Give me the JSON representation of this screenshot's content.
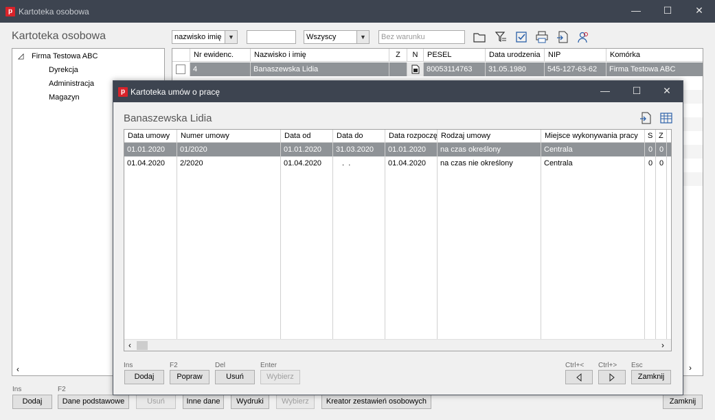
{
  "window": {
    "title": "Kartoteka osobowa"
  },
  "main": {
    "heading": "Kartoteka osobowa",
    "filter_field": "nazwisko imię",
    "search_value": "",
    "filter_scope": "Wszyscy",
    "condition_placeholder": "Bez warunku"
  },
  "tree": {
    "root": "Firma Testowa ABC",
    "children": [
      "Dyrekcja",
      "Administracja",
      "Magazyn"
    ]
  },
  "employees": {
    "columns": [
      "Nr ewidenc.",
      "Nazwisko i imię",
      "Z",
      "N",
      "PESEL",
      "Data urodzenia",
      "NIP",
      "Komórka"
    ],
    "rows": [
      {
        "nr": "4",
        "name": "Banaszewska Lidia",
        "z": "",
        "pesel": "80053114763",
        "birth": "31.05.1980",
        "nip": "545-127-63-62",
        "unit": "Firma Testowa ABC"
      }
    ]
  },
  "main_buttons": {
    "add_hotkey": "Ins",
    "add": "Dodaj",
    "basic_hotkey": "F2",
    "basic": "Dane podstawowe",
    "delete": "Usuń",
    "other": "Inne dane",
    "prints": "Wydruki",
    "choose": "Wybierz",
    "creator": "Kreator zestawień osobowych",
    "close": "Zamknij"
  },
  "dialog": {
    "title": "Kartoteka umów o pracę",
    "employee_name": "Banaszewska Lidia",
    "columns": [
      "Data umowy",
      "Numer umowy",
      "Data od",
      "Data do",
      "Data rozpoczęcia",
      "Rodzaj umowy",
      "Miejsce wykonywania pracy",
      "S",
      "Z"
    ],
    "rows": [
      {
        "date": "01.01.2020",
        "number": "01/2020",
        "from": "01.01.2020",
        "to": "31.03.2020",
        "start": "01.01.2020",
        "type": "na czas określony",
        "place": "Centrala",
        "s": "0",
        "z": "0"
      },
      {
        "date": "01.04.2020",
        "number": "2/2020",
        "from": "01.04.2020",
        "to": " .  .",
        "start": "01.04.2020",
        "type": "na czas nie określony",
        "place": "Centrala",
        "s": "0",
        "z": "0"
      }
    ],
    "buttons": {
      "add_hotkey": "Ins",
      "add": "Dodaj",
      "edit_hotkey": "F2",
      "edit": "Popraw",
      "delete_hotkey": "Del",
      "delete": "Usuń",
      "choose_hotkey": "Enter",
      "choose": "Wybierz",
      "prev_hotkey": "Ctrl+<",
      "next_hotkey": "Ctrl+>",
      "close_hotkey": "Esc",
      "close": "Zamknij"
    }
  },
  "colors": {
    "titlebar": "#3d4450",
    "selected_row": "#8f9397",
    "brand_icon": "#d9232a"
  }
}
